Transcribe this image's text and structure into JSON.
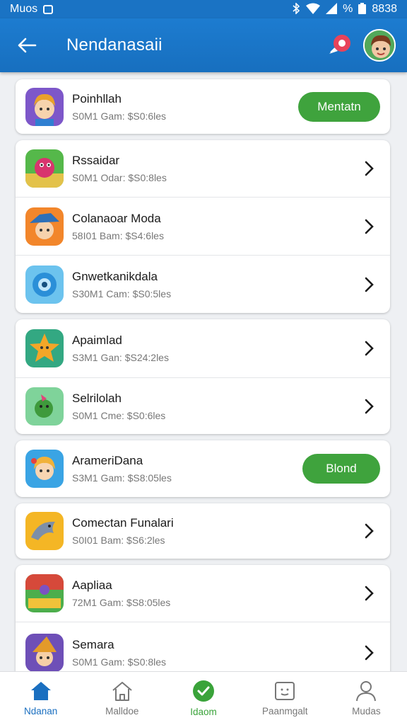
{
  "status_bar": {
    "left_text": "Muos",
    "time": "8838",
    "percent_glyph": "%"
  },
  "app_bar": {
    "title": "Nendanasaii"
  },
  "apps": [
    {
      "name": "Poinhllah",
      "meta": "S0M1 Gam: $S0:6les",
      "action": "button",
      "button_label": "Mentatn"
    },
    {
      "name": "Rssaidar",
      "meta": "S0M1 Odar: $S0:8les",
      "action": "chevron"
    },
    {
      "name": "Colanaoar Moda",
      "meta": "58I01 Bam: $S4:6les",
      "action": "chevron"
    },
    {
      "name": "Gnwetkanikdala",
      "meta": "S30M1 Cam: $S0:5les",
      "action": "chevron"
    },
    {
      "name": "Apaimlad",
      "meta": "S3M1 Gan: $S24:2les",
      "action": "chevron"
    },
    {
      "name": "Selrilolah",
      "meta": "S0M1 Cme: $S0:6les",
      "action": "chevron"
    },
    {
      "name": "ArameriDana",
      "meta": "S3M1 Gam: $S8:05les",
      "action": "button",
      "button_label": "Blond"
    },
    {
      "name": "Comectan Funalari",
      "meta": "S0I01 Bam: $S6:2les",
      "action": "chevron"
    },
    {
      "name": "Aapliaa",
      "meta": "72M1 Gam: $S8:05les",
      "action": "chevron"
    },
    {
      "name": "Semara",
      "meta": "S0M1 Gam: $S0:8les",
      "action": "chevron"
    }
  ],
  "bottom_nav": [
    {
      "label": "Ndanan",
      "icon": "home-icon"
    },
    {
      "label": "Malldoe",
      "icon": "house-outline-icon"
    },
    {
      "label": "Idaom",
      "icon": "check-circle-icon"
    },
    {
      "label": "Paanmgalt",
      "icon": "smiley-box-icon"
    },
    {
      "label": "Mudas",
      "icon": "person-icon"
    }
  ],
  "colors": {
    "primary": "#1a73c4",
    "accent_green": "#3fa33d",
    "background": "#eef0f3"
  }
}
